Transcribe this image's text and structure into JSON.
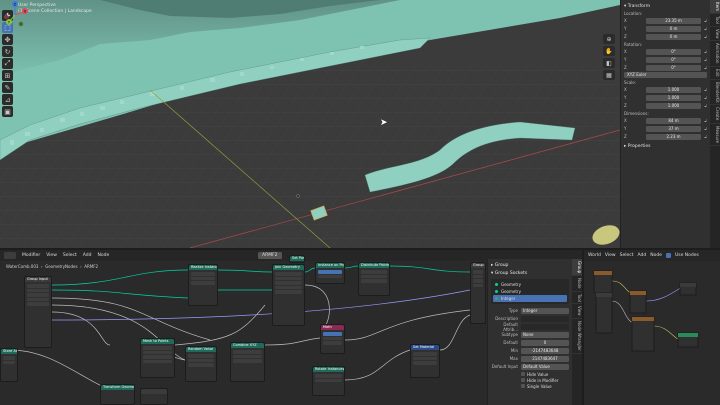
{
  "viewport": {
    "title_line1": "User Perspective",
    "title_line2": "(1) Scene Collection | Landscape",
    "tools": [
      "cursor-icon",
      "select-icon",
      "move-icon",
      "rotate-icon",
      "scale-icon",
      "transform-icon",
      "annotate-icon",
      "measure-icon",
      "add-cube-icon"
    ],
    "gizmo_axes": {
      "x": "X",
      "y": "Y",
      "z": "Z"
    },
    "colors": {
      "ground": "#3a3a3a",
      "terrain": "#7ec3b2",
      "x_axis": "#b04a4a",
      "y_axis": "#8ca23c"
    }
  },
  "npanel": {
    "transform_header": "Transform",
    "location_label": "Location:",
    "location": [
      {
        "axis": "X",
        "value": "23.35 m"
      },
      {
        "axis": "Y",
        "value": "0 m"
      },
      {
        "axis": "Z",
        "value": "0 m"
      }
    ],
    "rotation_label": "Rotation:",
    "rotation": [
      {
        "axis": "X",
        "value": "0°"
      },
      {
        "axis": "Y",
        "value": "0°"
      },
      {
        "axis": "Z",
        "value": "0°"
      }
    ],
    "rotation_mode": "XYZ Euler",
    "scale_label": "Scale:",
    "scale": [
      {
        "axis": "X",
        "value": "1.000"
      },
      {
        "axis": "Y",
        "value": "1.000"
      },
      {
        "axis": "Z",
        "value": "1.000"
      }
    ],
    "dimensions_label": "Dimensions:",
    "dimensions": [
      {
        "axis": "X",
        "value": "84 m"
      },
      {
        "axis": "Y",
        "value": "37 m"
      },
      {
        "axis": "Z",
        "value": "2.23 m"
      }
    ],
    "properties_header": "Properties",
    "tabs": [
      "Item",
      "Tool",
      "View",
      "Animation",
      "Edit",
      "BlenderKit",
      "Create",
      "Measure"
    ]
  },
  "node_editor": {
    "menu": [
      "Modifier",
      "View",
      "Select",
      "Add",
      "Node"
    ],
    "object_name": "WaterComb.003",
    "modifier_name": "GeometryNodes",
    "tree_name": "ARMF2",
    "nodes": [
      "Group Input",
      "Realize Instances",
      "Join Geometry",
      "Set Position",
      "Instance on Points",
      "Distribute Points",
      "Group Output",
      "Mesh to Points",
      "Random Value",
      "Combine XYZ",
      "Math",
      "Rotate Instances",
      "Set Material",
      "Store Attribute",
      "Transform Geometry"
    ],
    "group_panel": {
      "group_header": "Group",
      "sockets_header": "Group Sockets",
      "sockets": [
        {
          "name": "Geometry",
          "selected": false
        },
        {
          "name": "Geometry",
          "selected": false
        },
        {
          "name": "Integer",
          "selected": true
        }
      ],
      "props": {
        "type_label": "Type",
        "type_value": "Integer",
        "description_label": "Description",
        "description_value": "",
        "default_attr_label": "Default Attrib...",
        "default_attr_value": "",
        "subtype_label": "Subtype",
        "subtype_value": "None",
        "default_label": "Default",
        "default_value": "0",
        "min_label": "Min",
        "min_value": "-2147483648",
        "max_label": "Max",
        "max_value": "2147483647",
        "default_input_label": "Default Input",
        "default_input_value": "Default Value"
      },
      "checkboxes": [
        "Hide Value",
        "Hide in Modifier",
        "Single Value"
      ]
    },
    "side_tabs": [
      "Group",
      "Node",
      "Tool",
      "View",
      "Node Wrangler"
    ]
  },
  "mini_editor": {
    "menu": [
      "World",
      "View",
      "Select",
      "Add",
      "Node"
    ],
    "use_nodes_label": "Use Nodes"
  }
}
